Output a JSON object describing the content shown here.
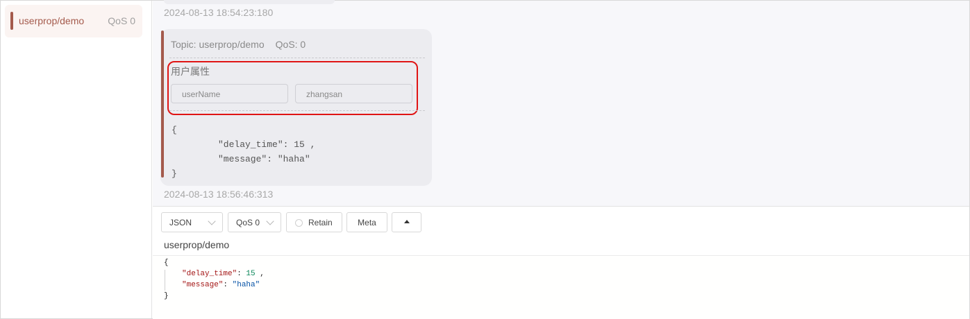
{
  "sidebar": {
    "subscriptions": [
      {
        "topic": "userprop/demo",
        "qos_label": "QoS 0",
        "color": "#a45a4c"
      }
    ]
  },
  "messages": {
    "prev_timestamp": "2024-08-13 18:54:23:180",
    "current": {
      "topic_label": "Topic: userprop/demo",
      "qos_label": "QoS: 0",
      "user_properties_title": "用户属性",
      "user_properties": [
        {
          "key": "userName",
          "value": "zhangsan"
        }
      ],
      "payload_lines": [
        "{",
        "\"delay_time\": 15 ,",
        "\"message\": \"haha\"",
        "}"
      ],
      "timestamp": "2024-08-13 18:56:46:313"
    }
  },
  "publish": {
    "format_select": "JSON",
    "qos_select": "QoS 0",
    "retain_label": "Retain",
    "meta_label": "Meta",
    "topic": "userprop/demo",
    "editor": {
      "open_brace": "{",
      "line1_key": "\"delay_time\"",
      "line1_sep": ": ",
      "line1_value": "15",
      "line1_tail": " ,",
      "line2_key": "\"message\"",
      "line2_sep": ": ",
      "line2_value": "\"haha\"",
      "close_brace": "}"
    }
  },
  "colors": {
    "accent": "#a45a4c",
    "highlight_box": "#e01414"
  },
  "icons": [
    "chevron-down-icon",
    "radio-icon",
    "caret-up-icon"
  ]
}
